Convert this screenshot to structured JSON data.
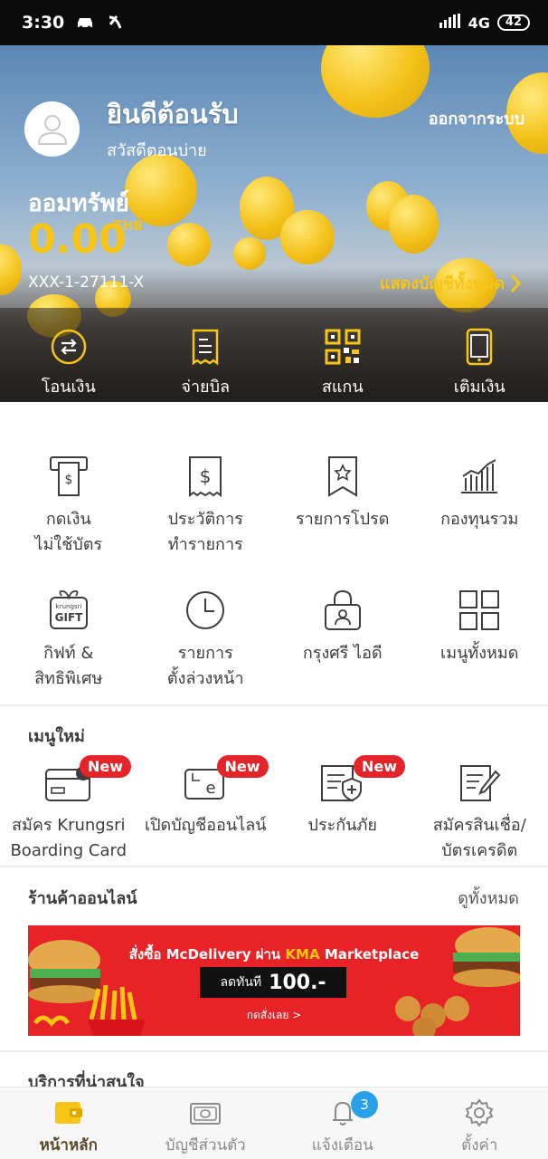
{
  "status_bar": {
    "time": "3:30",
    "network": "4G",
    "battery": "42"
  },
  "header": {
    "welcome": "ยินดีต้อนรับ",
    "greeting": "สวัสดีตอนบ่าย",
    "logout_label": "ออกจากระบบ",
    "account_type": "ออมทรัพย์",
    "balance": "0.00",
    "currency": "THB",
    "account_number": "XXX-1-27111-X",
    "show_all_accounts": "แสดงบัญชีทั้งหมด"
  },
  "quick_actions": [
    {
      "label": "โอนเงิน",
      "icon": "transfer-icon"
    },
    {
      "label": "จ่ายบิล",
      "icon": "bill-icon"
    },
    {
      "label": "สแกน",
      "icon": "qr-scan-icon"
    },
    {
      "label": "เติมเงิน",
      "icon": "phone-topup-icon"
    }
  ],
  "menu_row1": [
    {
      "line1": "กดเงิน",
      "line2": "ไม่ใช้บัตร",
      "icon": "cardless-withdraw-icon"
    },
    {
      "line1": "ประวัติการ",
      "line2": "ทำรายการ",
      "icon": "transaction-history-icon"
    },
    {
      "line1": "รายการโปรด",
      "line2": "",
      "icon": "favorite-bookmark-icon"
    },
    {
      "line1": "กองทุนรวม",
      "line2": "",
      "icon": "mutual-fund-chart-icon"
    }
  ],
  "menu_row2": [
    {
      "line1": "กิฟท์ &",
      "line2": "สิทธิพิเศษ",
      "icon": "gift-icon",
      "icon_text_top": "krungsri",
      "icon_text": "GIFT"
    },
    {
      "line1": "รายการ",
      "line2": "ตั้งล่วงหน้า",
      "icon": "clock-icon"
    },
    {
      "line1": "กรุงศรี ไอดี",
      "line2": "",
      "icon": "krungsri-id-lock-icon"
    },
    {
      "line1": "เมนูทั้งหมด",
      "line2": "",
      "icon": "all-menu-grid-icon"
    }
  ],
  "new_menu": {
    "title": "เมนูใหม่",
    "badge": "New",
    "items": [
      {
        "line1": "สมัคร Krungsri",
        "line2": "Boarding Card",
        "icon": "boarding-card-icon",
        "is_new": true
      },
      {
        "line1": "เปิดบัญชีออนไลน์",
        "line2": "",
        "icon": "open-account-online-icon",
        "is_new": true
      },
      {
        "line1": "ประกันภัย",
        "line2": "",
        "icon": "insurance-shield-icon",
        "is_new": true
      },
      {
        "line1": "สมัครสินเชื่อ/",
        "line2": "บัตรเครดิต",
        "icon": "loan-application-icon",
        "is_new": false
      }
    ]
  },
  "online_shop": {
    "title": "ร้านค้าออนไลน์",
    "see_all": "ดูทั้งหมด",
    "banner": {
      "prefix": "สั่งซื้อ",
      "brand": "McDelivery",
      "via": "ผ่าน",
      "marketplace_logo": "KMA",
      "marketplace": "Marketplace",
      "discount_prefix": "ลดทันที",
      "discount": "100.-",
      "cta": "กดสั่งเลย >"
    }
  },
  "services": {
    "title": "บริการที่น่าสนใจ"
  },
  "bottom_nav": [
    {
      "label": "หน้าหลัก",
      "icon": "wallet-home-icon",
      "active": true
    },
    {
      "label": "บัญชีส่วนตัว",
      "icon": "personal-account-icon",
      "active": false
    },
    {
      "label": "แจ้งเตือน",
      "icon": "bell-icon",
      "active": false,
      "badge": "3"
    },
    {
      "label": "ตั้งค่า",
      "icon": "gear-icon",
      "active": false
    }
  ],
  "colors": {
    "accent": "#f7c516",
    "badge_red": "#e4242b",
    "notif_blue": "#2aa0e8",
    "banner_red": "#e82327"
  }
}
